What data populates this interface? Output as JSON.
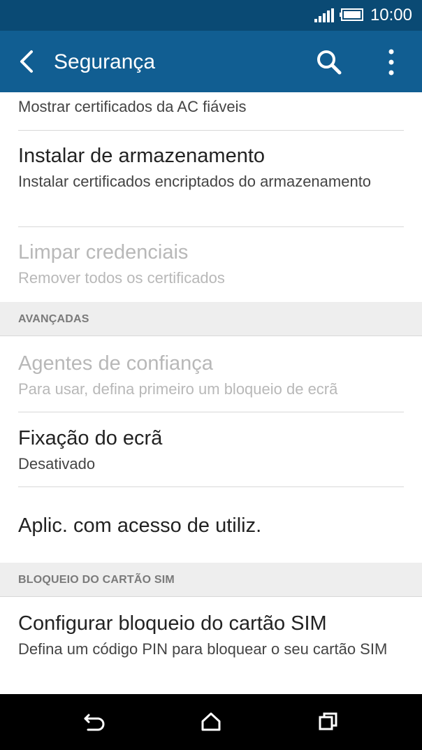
{
  "status_bar": {
    "time": "10:00",
    "icons": [
      "signal-icon",
      "battery-icon"
    ]
  },
  "app_bar": {
    "title": "Segurança",
    "back_icon": "back-arrow-icon",
    "search_icon": "search-icon",
    "overflow_icon": "more-vertical-icon",
    "background": "#115e92",
    "status_background": "#0a4a74"
  },
  "items": {
    "trusted_certs": {
      "summary": "Mostrar certificados da AC fiáveis"
    },
    "install_storage": {
      "title": "Instalar de armazenamento",
      "summary": "Instalar certificados encriptados do armazenamento"
    },
    "clear_credentials": {
      "title": "Limpar credenciais",
      "summary": "Remover todos os certificados",
      "enabled": false
    },
    "trust_agents": {
      "title": "Agentes de confiança",
      "summary": "Para usar, defina primeiro um bloqueio de ecrã",
      "enabled": false
    },
    "screen_pinning": {
      "title": "Fixação do ecrã",
      "summary": "Desativado"
    },
    "usage_access": {
      "title": "Aplic. com acesso de utiliz."
    },
    "sim_lock": {
      "title": "Configurar bloqueio do cartão SIM",
      "summary": "Defina um código PIN para bloquear o seu cartão SIM"
    }
  },
  "sections": {
    "advanced": "AVANÇADAS",
    "sim_lock": "BLOQUEIO DO CARTÃO SIM"
  },
  "nav_bar": {
    "icons": [
      "back-icon",
      "home-icon",
      "recents-icon"
    ]
  }
}
